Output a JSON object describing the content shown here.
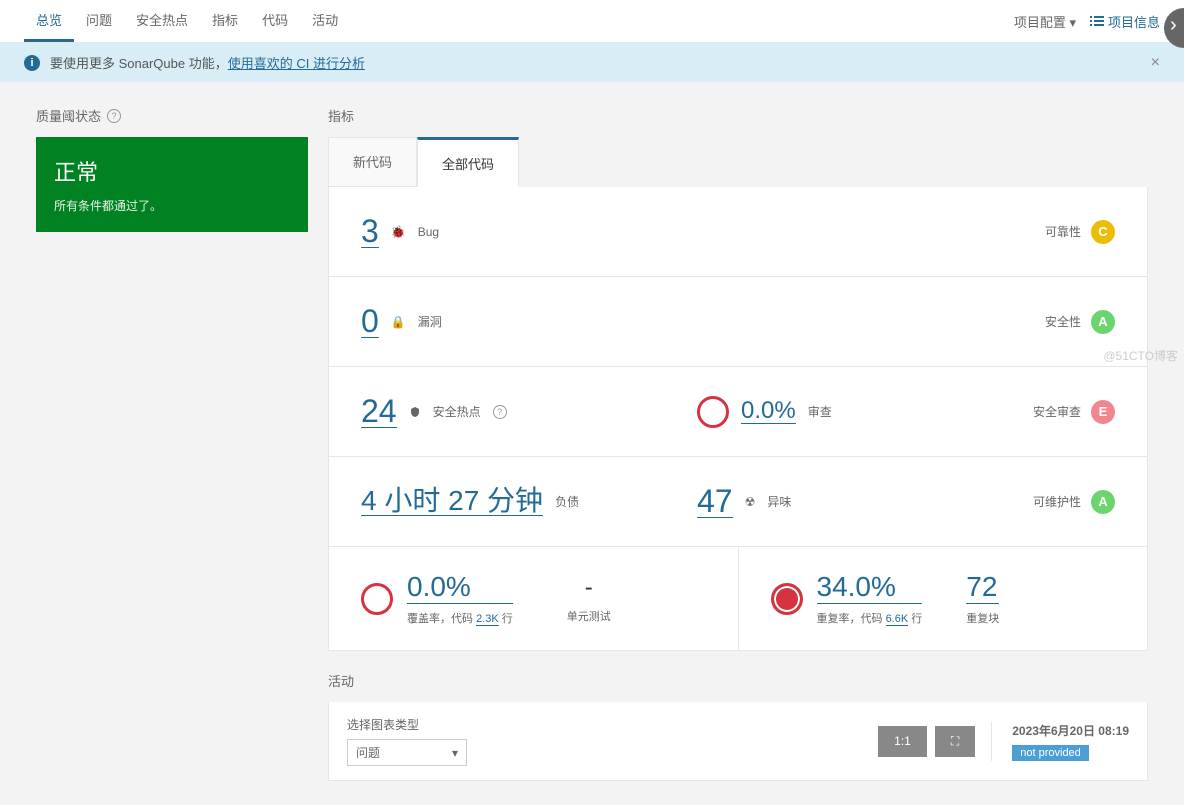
{
  "nav": {
    "items": [
      "总览",
      "问题",
      "安全热点",
      "指标",
      "代码",
      "活动"
    ],
    "projectConfig": "项目配置",
    "projectInfo": "项目信息"
  },
  "banner": {
    "text": "要使用更多 SonarQube 功能，",
    "link": "使用喜欢的 CI 进行分析"
  },
  "sidebar": {
    "title": "质量阈状态",
    "status": "正常",
    "desc": "所有条件都通过了。"
  },
  "content": {
    "title": "指标",
    "tabs": [
      "新代码",
      "全部代码"
    ]
  },
  "metrics": {
    "bugs": {
      "value": "3",
      "label": "Bug",
      "ratingLabel": "可靠性",
      "rating": "C"
    },
    "vuln": {
      "value": "0",
      "label": "漏洞",
      "ratingLabel": "安全性",
      "rating": "A"
    },
    "hotspots": {
      "value": "24",
      "label": "安全热点",
      "reviewValue": "0.0%",
      "reviewLabel": "审查",
      "ratingLabel": "安全审查",
      "rating": "E"
    },
    "debt": {
      "value": "4 小时 27 分钟",
      "label": "负债",
      "smellValue": "47",
      "smellLabel": "异味",
      "ratingLabel": "可维护性",
      "rating": "A"
    },
    "coverage": {
      "value": "0.0%",
      "descPrefix": "覆盖率，代码",
      "lines": "2.3K",
      "descSuffix": "行",
      "unitLabel": "单元测试",
      "unitValue": "-"
    },
    "dup": {
      "value": "34.0%",
      "descPrefix": "重复率，代码",
      "lines": "6.6K",
      "descSuffix": "行",
      "blocksValue": "72",
      "blocksLabel": "重复块"
    }
  },
  "activity": {
    "title": "活动",
    "chartTypeLabel": "选择图表类型",
    "chartType": "问题",
    "scale1": "1:1",
    "scaleFit": "⛶",
    "date": "2023年6月20日 08:19",
    "notProvided": "not provided"
  },
  "watermark": "@51CTO博客"
}
